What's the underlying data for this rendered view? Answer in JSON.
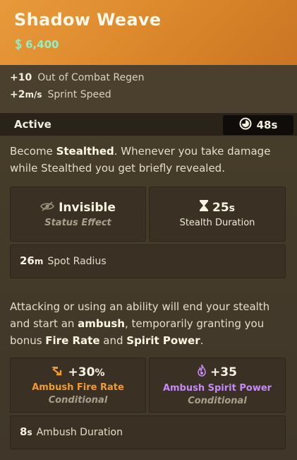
{
  "item": {
    "title": "Shadow Weave",
    "cost": "6,400",
    "cost_icon": "souls-currency-icon"
  },
  "passive_stats": [
    {
      "value": "+10",
      "unit": "",
      "label": "Out of Combat Regen"
    },
    {
      "value": "+2",
      "unit": "m/s",
      "label": "Sprint Speed"
    }
  ],
  "active": {
    "label": "Active",
    "cooldown": "48s",
    "cooldown_icon": "cooldown-clock-icon"
  },
  "description1": {
    "parts": [
      "Become ",
      "Stealthed",
      ". Whenever you take damage while Stealthed you get briefly revealed."
    ]
  },
  "stealth_stats": {
    "invisible": {
      "value": "Invisible",
      "sub": "Status Effect",
      "icon": "eye-slash-icon"
    },
    "duration": {
      "value": "25",
      "unit": "s",
      "sub": "Stealth Duration",
      "icon": "hourglass-icon"
    },
    "spot": {
      "value": "26",
      "unit": "m",
      "label": "Spot Radius"
    }
  },
  "description2": {
    "parts": [
      "Attacking or using an ability will end your stealth and start an ",
      "ambush",
      ", temporarily granting you bonus ",
      "Fire Rate",
      " and ",
      "Spirit Power",
      "."
    ]
  },
  "ambush_stats": {
    "fire_rate": {
      "value": "+30",
      "unit": "%",
      "label": "Ambush Fire Rate",
      "cond": "Conditional",
      "icon": "fire-rate-icon",
      "color": "#f39a2c"
    },
    "spirit": {
      "value": "+35",
      "unit": "",
      "label": "Ambush Spirit Power",
      "cond": "Conditional",
      "icon": "spirit-flame-icon",
      "color": "#c48af5"
    },
    "duration": {
      "value": "8",
      "unit": "s",
      "label": "Ambush Duration"
    }
  },
  "colors": {
    "header_orange": "#e0902f",
    "cost_green": "#8ff0c4",
    "fire_orange": "#f39a2c",
    "spirit_purple": "#c48af5"
  }
}
